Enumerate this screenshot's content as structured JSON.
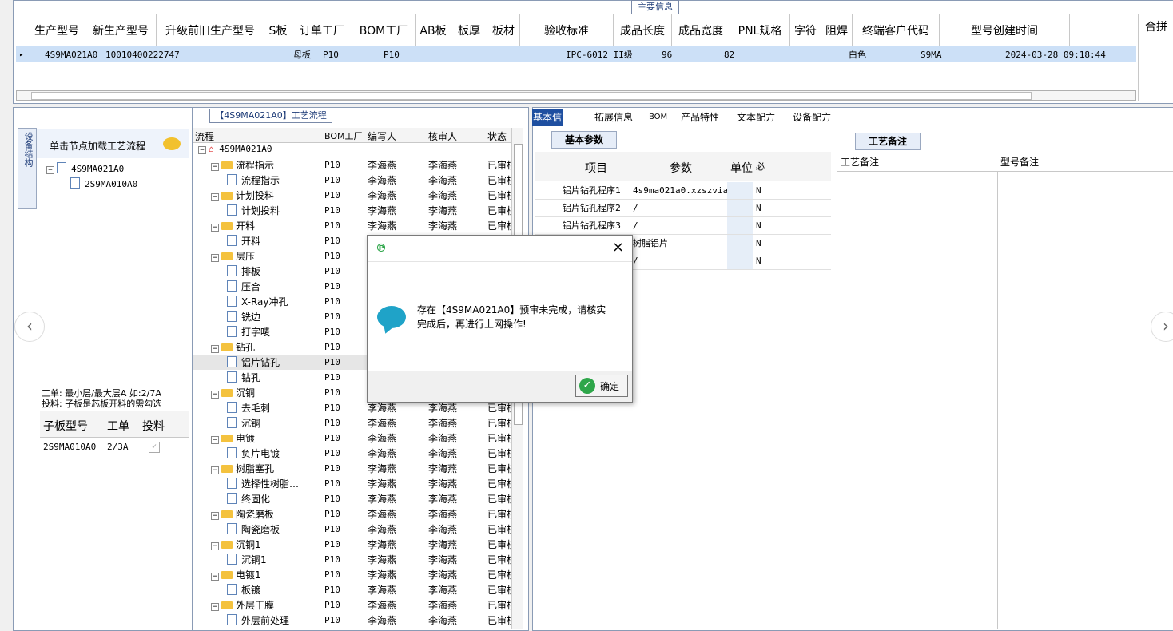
{
  "main": {
    "title": "主要信息",
    "columns": [
      "生产型号",
      "新生产型号",
      "升级前旧生产型号",
      "S板",
      "订单工厂",
      "BOM工厂",
      "AB板",
      "板厚",
      "板材",
      "验收标准",
      "成品长度",
      "成品宽度",
      "PNL规格",
      "字符",
      "阻焊",
      "终端客户代码",
      "型号创建时间",
      "合拼"
    ],
    "row": {
      "model": "4S9MA021A0",
      "new_model": "10010400222747",
      "s_board": "母板",
      "order_factory": "P10",
      "bom_factory": "P10",
      "standard": "IPC-6012 II级",
      "length": "96",
      "width": "82",
      "char": "白色",
      "customer": "S9MA",
      "created": "2024-03-28 09:18:44"
    }
  },
  "left": {
    "vtab": "设备结构",
    "hint": "单击节点加载工艺流程",
    "tree_root": "4S9MA021A0",
    "tree_child": "2S9MA010A0",
    "note_line1": "工单: 最小层/最大层A 如:2/7A",
    "note_line2": "投料: 子板是芯板开料的需勾选",
    "sub_headers": [
      "子板型号",
      "工单",
      "投料"
    ],
    "sub_row": {
      "model": "2S9MA010A0",
      "order": "2/3A",
      "check": "✓"
    }
  },
  "mid": {
    "title": "【4S9MA021A0】工艺流程",
    "headers": [
      "流程",
      "BOM工厂",
      "编写人",
      "核审人",
      "状态"
    ],
    "root": "4S9MA021A0",
    "rows": [
      {
        "label": "流程指示",
        "folder": true,
        "f": "P10",
        "w": "李海燕",
        "c": "李海燕",
        "s": "已审核"
      },
      {
        "label": "流程指示",
        "folder": false,
        "f": "P10",
        "w": "李海燕",
        "c": "李海燕",
        "s": "已审核"
      },
      {
        "label": "计划投料",
        "folder": true,
        "f": "P10",
        "w": "李海燕",
        "c": "李海燕",
        "s": "已审核"
      },
      {
        "label": "计划投料",
        "folder": false,
        "f": "P10",
        "w": "李海燕",
        "c": "李海燕",
        "s": "已审核"
      },
      {
        "label": "开料",
        "folder": true,
        "f": "P10",
        "w": "李海燕",
        "c": "李海燕",
        "s": "已审核"
      },
      {
        "label": "开料",
        "folder": false,
        "f": "P10",
        "w": "",
        "c": "",
        "s": ""
      },
      {
        "label": "层压",
        "folder": true,
        "f": "P10",
        "w": "",
        "c": "",
        "s": ""
      },
      {
        "label": "排板",
        "folder": false,
        "f": "P10",
        "w": "",
        "c": "",
        "s": ""
      },
      {
        "label": "压合",
        "folder": false,
        "f": "P10",
        "w": "",
        "c": "",
        "s": ""
      },
      {
        "label": "X-Ray冲孔",
        "folder": false,
        "f": "P10",
        "w": "",
        "c": "",
        "s": ""
      },
      {
        "label": "铣边",
        "folder": false,
        "f": "P10",
        "w": "",
        "c": "",
        "s": ""
      },
      {
        "label": "打字唛",
        "folder": false,
        "f": "P10",
        "w": "",
        "c": "",
        "s": ""
      },
      {
        "label": "钻孔",
        "folder": true,
        "f": "P10",
        "w": "",
        "c": "",
        "s": ""
      },
      {
        "label": "铝片钻孔",
        "folder": false,
        "f": "P10",
        "w": "",
        "c": "",
        "s": "",
        "sel": true
      },
      {
        "label": "钻孔",
        "folder": false,
        "f": "P10",
        "w": "",
        "c": "",
        "s": ""
      },
      {
        "label": "沉铜",
        "folder": true,
        "f": "P10",
        "w": "",
        "c": "",
        "s": ""
      },
      {
        "label": "去毛刺",
        "folder": false,
        "f": "P10",
        "w": "李海燕",
        "c": "李海燕",
        "s": "已审核"
      },
      {
        "label": "沉铜",
        "folder": false,
        "f": "P10",
        "w": "李海燕",
        "c": "李海燕",
        "s": "已审核"
      },
      {
        "label": "电镀",
        "folder": true,
        "f": "P10",
        "w": "李海燕",
        "c": "李海燕",
        "s": "已审核"
      },
      {
        "label": "负片电镀",
        "folder": false,
        "f": "P10",
        "w": "李海燕",
        "c": "李海燕",
        "s": "已审核"
      },
      {
        "label": "树脂塞孔",
        "folder": true,
        "f": "P10",
        "w": "李海燕",
        "c": "李海燕",
        "s": "已审核"
      },
      {
        "label": "选择性树脂…",
        "folder": false,
        "f": "P10",
        "w": "李海燕",
        "c": "李海燕",
        "s": "已审核"
      },
      {
        "label": "终固化",
        "folder": false,
        "f": "P10",
        "w": "李海燕",
        "c": "李海燕",
        "s": "已审核"
      },
      {
        "label": "陶瓷磨板",
        "folder": true,
        "f": "P10",
        "w": "李海燕",
        "c": "李海燕",
        "s": "已审核"
      },
      {
        "label": "陶瓷磨板",
        "folder": false,
        "f": "P10",
        "w": "李海燕",
        "c": "李海燕",
        "s": "已审核"
      },
      {
        "label": "沉铜1",
        "folder": true,
        "f": "P10",
        "w": "李海燕",
        "c": "李海燕",
        "s": "已审核"
      },
      {
        "label": "沉铜1",
        "folder": false,
        "f": "P10",
        "w": "李海燕",
        "c": "李海燕",
        "s": "已审核"
      },
      {
        "label": "电镀1",
        "folder": true,
        "f": "P10",
        "w": "李海燕",
        "c": "李海燕",
        "s": "已审核"
      },
      {
        "label": "板镀",
        "folder": false,
        "f": "P10",
        "w": "李海燕",
        "c": "李海燕",
        "s": "已审核"
      },
      {
        "label": "外层干膜",
        "folder": true,
        "f": "P10",
        "w": "李海燕",
        "c": "李海燕",
        "s": "已审核"
      },
      {
        "label": "外层前处理",
        "folder": false,
        "f": "P10",
        "w": "李海燕",
        "c": "李海燕",
        "s": "已审核"
      }
    ]
  },
  "right": {
    "tabs": [
      "基本信息",
      "拓展信息",
      "BOM",
      "产品特性",
      "文本配方",
      "设备配方"
    ],
    "subtab": "基本参数",
    "param_headers": [
      "项目",
      "参数",
      "单位",
      "必"
    ],
    "params": [
      {
        "item": "铝片钻孔程序1",
        "value": "4s9ma021a0.xzszvia",
        "req": "N"
      },
      {
        "item": "铝片钻孔程序2",
        "value": "/",
        "req": "N"
      },
      {
        "item": "铝片钻孔程序3",
        "value": "/",
        "req": "N"
      },
      {
        "item": "",
        "value": "树脂铝片",
        "req": "N"
      },
      {
        "item": "",
        "value": "/",
        "req": "N"
      }
    ],
    "note_tab": "工艺备注",
    "note_col1": "工艺备注",
    "note_col2": "型号备注"
  },
  "dialog": {
    "message_line1": "存在【4S9MA021A0】预审未完成，请核实",
    "message_line2": "完成后，再进行上网操作!",
    "ok": "确定",
    "close": "×"
  },
  "nav": {
    "prev": "‹",
    "next": "›"
  }
}
